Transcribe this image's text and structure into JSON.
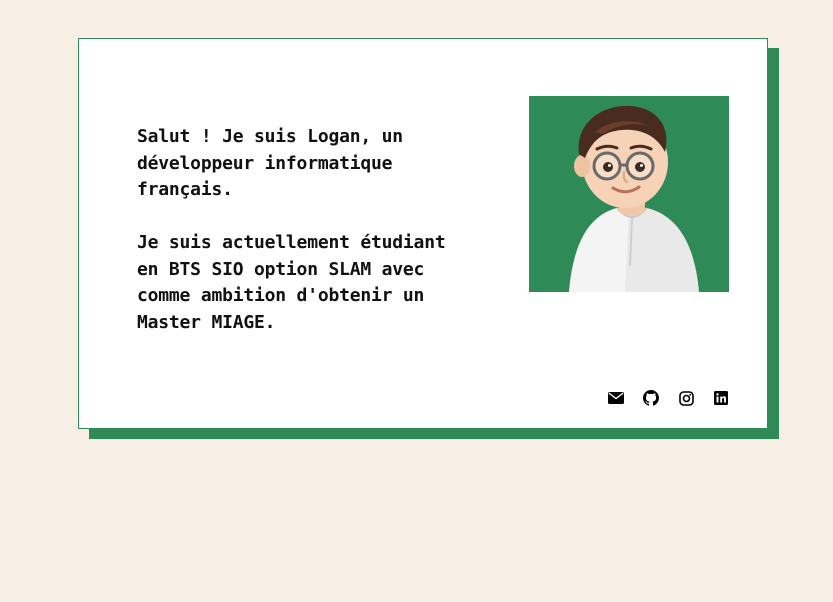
{
  "intro": {
    "line1": "Salut ! Je suis Logan, un développeur informatique français.",
    "line2": "Je suis actuellement étudiant en BTS SIO option SLAM avec comme ambition d'obtenir un Master MIAGE."
  },
  "photo": {
    "alt": "Memoji avatar of Logan",
    "background_color": "#2e8b57"
  },
  "socials": [
    {
      "name": "email",
      "icon": "envelope-icon"
    },
    {
      "name": "github",
      "icon": "github-icon"
    },
    {
      "name": "instagram",
      "icon": "instagram-icon"
    },
    {
      "name": "linkedin",
      "icon": "linkedin-icon"
    }
  ],
  "colors": {
    "background": "#f7efe5",
    "accent": "#2e8b57",
    "card": "#ffffff",
    "text": "#111111"
  }
}
